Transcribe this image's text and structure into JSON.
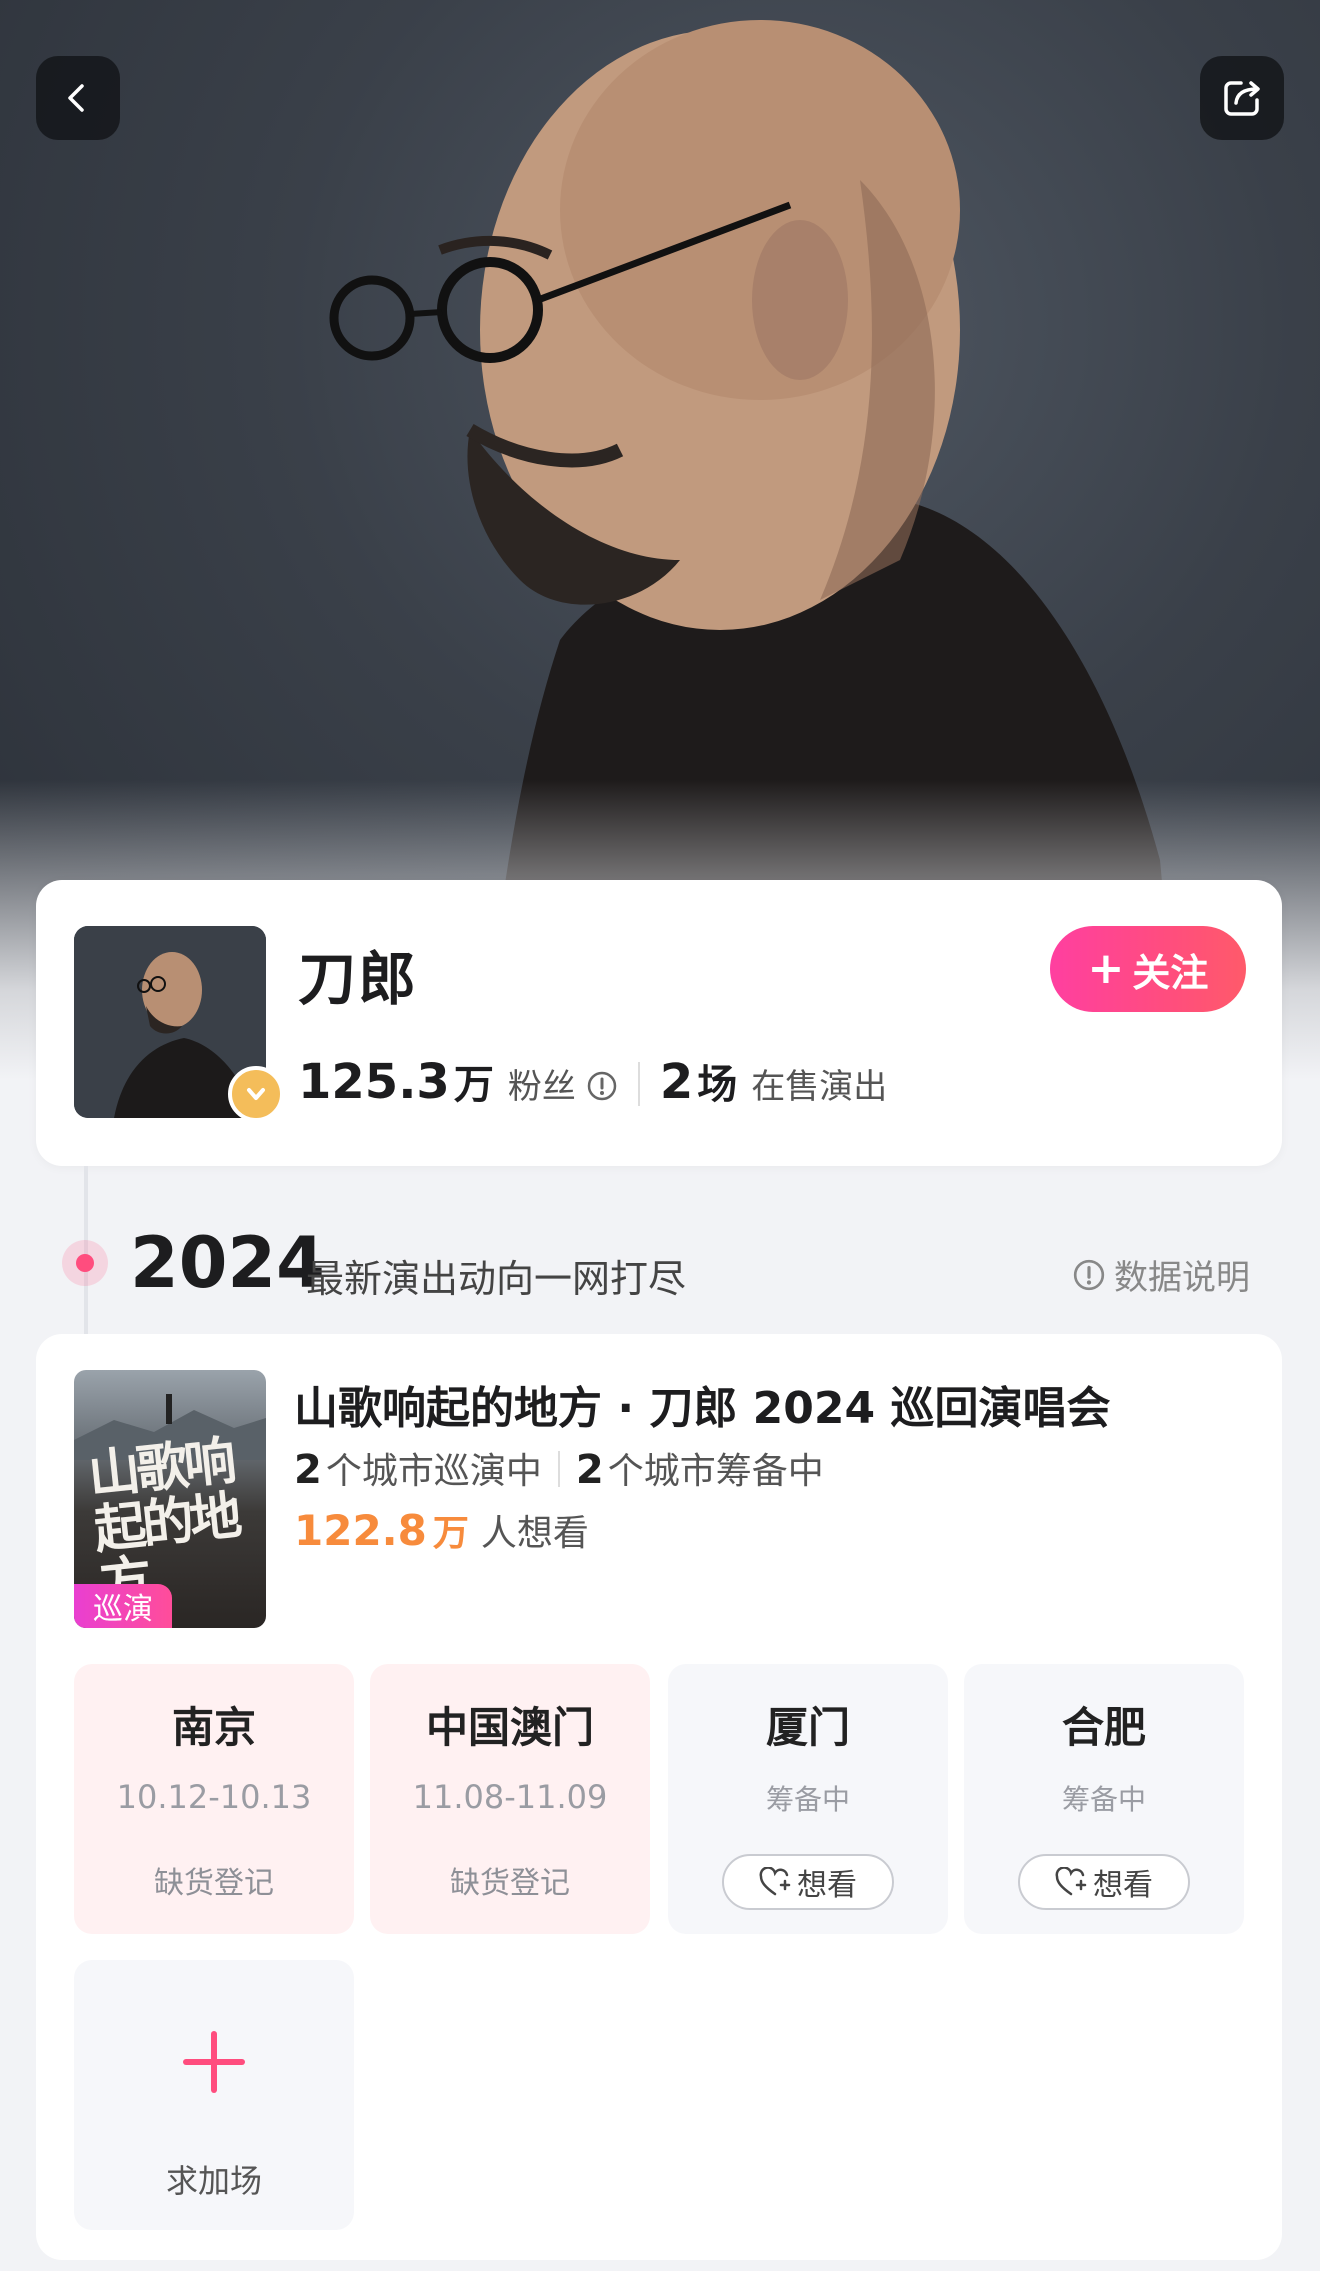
{
  "nav": {
    "back_icon": "chevron-left-icon",
    "share_icon": "share-icon"
  },
  "artist": {
    "name": "刀郎",
    "fans_count": "125.3",
    "fans_unit": "万",
    "fans_label": "粉丝",
    "shows_count": "2",
    "shows_unit": "场",
    "shows_label": "在售演出",
    "follow_label": "关注"
  },
  "timeline": {
    "year": "2024",
    "subtitle": "最新演出动向一网打尽",
    "data_note": "数据说明"
  },
  "tour": {
    "poster_text": "山歌响起的地方",
    "tag": "巡演",
    "title": "山歌响起的地方 · 刀郎 2024 巡回演唱会",
    "touring_count": "2",
    "touring_label": "个城市巡演中",
    "planning_count": "2",
    "planning_label": "个城市筹备中",
    "want_count": "122.8",
    "want_unit": "万",
    "want_label": "人想看",
    "cities": [
      {
        "name": "南京",
        "date": "10.12-10.13",
        "action": "缺货登记"
      },
      {
        "name": "中国澳门",
        "date": "11.08-11.09",
        "action": "缺货登记"
      },
      {
        "name": "厦门",
        "date": "筹备中",
        "action": "想看"
      },
      {
        "name": "合肥",
        "date": "筹备中",
        "action": "想看"
      }
    ],
    "add_show_label": "求加场"
  },
  "colors": {
    "accent_pink": "#ff4d7e",
    "want_orange": "#f78b3c",
    "badge_gold": "#f4bd5a"
  }
}
